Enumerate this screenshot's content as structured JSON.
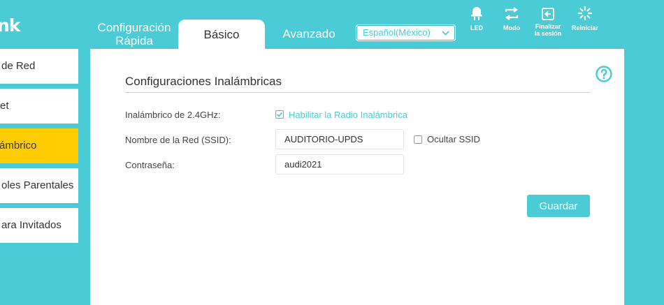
{
  "header": {
    "logo_text": "nk",
    "tabs": {
      "quick_setup": "Configuración Rápida",
      "basic": "Básico",
      "advanced": "Avanzado"
    },
    "language": {
      "selected": "Español(México)"
    },
    "actions": {
      "led": "LED",
      "mode": "Modo",
      "logout_line1": "Finalizar",
      "logout_line2": "la sesión",
      "reboot": "Reiniciar"
    }
  },
  "sidebar": {
    "items": [
      {
        "label": "de Red"
      },
      {
        "label": "et"
      },
      {
        "label": "ámbrico",
        "active": true
      },
      {
        "label": "oles Parentales"
      },
      {
        "label": "ara Invitados"
      }
    ]
  },
  "wireless": {
    "title": "Configuraciones Inalámbricas",
    "band_label": "Inalámbrico de 2.4GHz:",
    "enable_label": "Habilitar la Radio Inalámbrica",
    "enable_checked": true,
    "ssid_label": "Nombre de la Red (SSID):",
    "ssid_value": "AUDITORIO-UPDS",
    "hide_ssid_label": "Ocultar SSID",
    "hide_ssid_checked": false,
    "password_label": "Contraseña:",
    "password_value": "audi2021",
    "save_label": "Guardar"
  },
  "colors": {
    "accent": "#4acbd6",
    "active_sidebar": "#ffcc00"
  },
  "icons": [
    "chevron-down-icon",
    "led-icon",
    "mode-icon",
    "logout-icon",
    "reboot-icon",
    "help-icon",
    "checkmark-icon"
  ]
}
